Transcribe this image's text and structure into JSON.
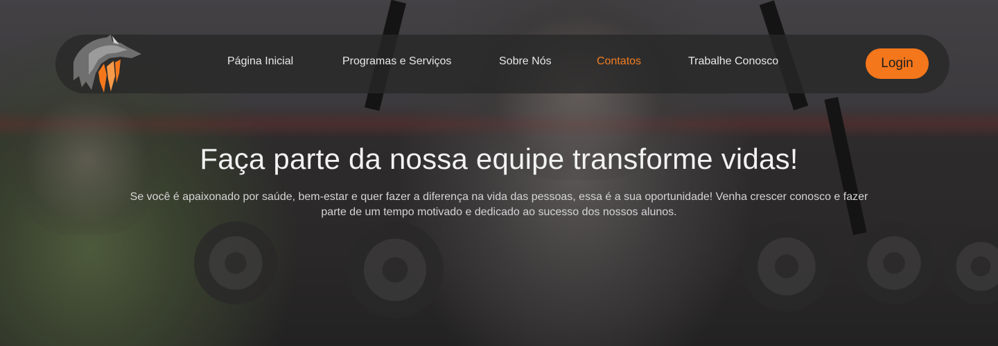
{
  "nav": {
    "logo": "wolf-logo-icon",
    "items": [
      {
        "label": "Página Inicial",
        "active": false
      },
      {
        "label": "Programas e Serviços",
        "active": false
      },
      {
        "label": "Sobre Nós",
        "active": false
      },
      {
        "label": "Contatos",
        "active": true
      },
      {
        "label": "Trabalhe Conosco",
        "active": false
      }
    ],
    "login_label": "Login"
  },
  "hero": {
    "title": "Faça parte da nossa equipe transforme vidas!",
    "subtitle": "Se você é apaixonado por saúde, bem-estar e quer fazer a diferença na vida das pessoas, essa é a sua oportunidade! Venha crescer conosco e fazer parte de um tempo motivado e dedicado ao sucesso dos nossos alunos."
  },
  "colors": {
    "accent": "#f4771c",
    "active_link": "#f37e22",
    "nav_bg": "#282828"
  }
}
